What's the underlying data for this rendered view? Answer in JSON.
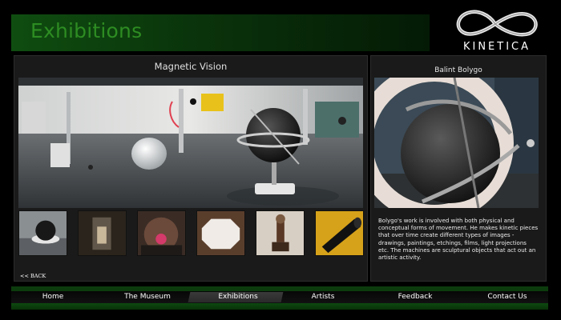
{
  "header": {
    "title": "Exhibitions"
  },
  "logo": {
    "wordmark": "KINETICA",
    "icon": "infinity-logo-icon"
  },
  "exhibit": {
    "title": "Magnetic Vision",
    "main_image": "gallery-panorama-image",
    "thumbnails": [
      "black-sphere-thumbnail",
      "glass-case-thumbnail",
      "red-glow-thumbnail",
      "octagon-thumbnail",
      "pedestal-sculpture-thumbnail",
      "cone-thumbnail"
    ]
  },
  "artist": {
    "name": "Balint Bolygo",
    "image": "sphere-sculpture-closeup-image",
    "description": "Bolygo's work is involved with both physical and conceptual forms of movement. He makes kinetic pieces that over time create different types of images - drawings, paintings, etchings, films, light projections etc. The machines are sculptural objects that act out an artistic activity."
  },
  "back_link": "<< BACK",
  "nav": {
    "items": [
      "Home",
      "The Museum",
      "Exhibitions",
      "Artists",
      "Feedback",
      "Contact Us"
    ],
    "active": "Exhibitions"
  },
  "colors": {
    "title_green": "#2d8c22",
    "header_green": "#0f4d10",
    "nav_green": "#0c3b0d",
    "panel_bg": "#1a1a1a"
  }
}
